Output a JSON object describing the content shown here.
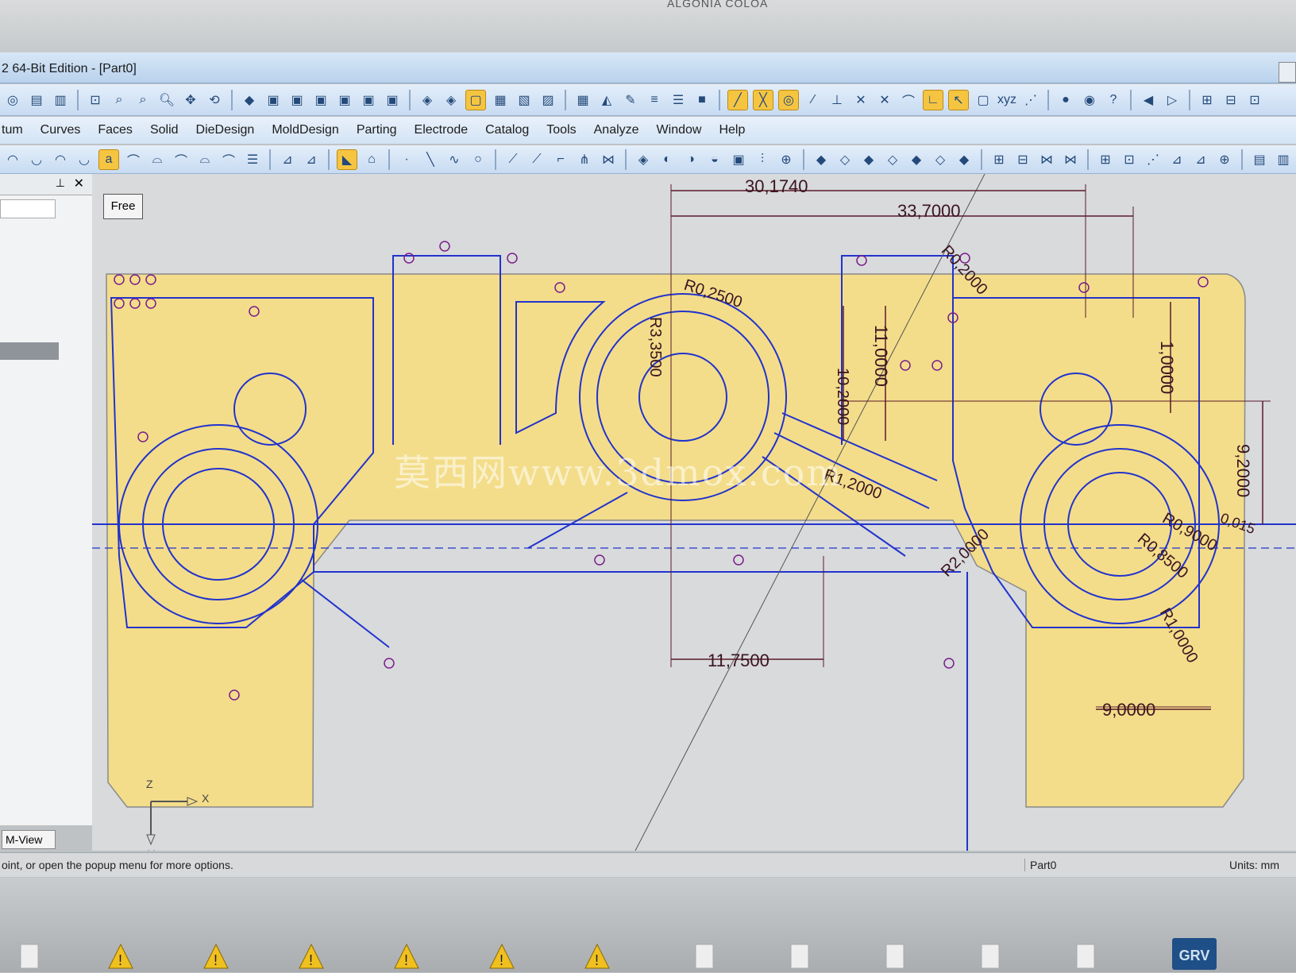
{
  "window": {
    "title": "2 64-Bit Edition - [Part0]"
  },
  "monitor": {
    "brand": "ALGONIA COLOA"
  },
  "menu": [
    "tum",
    "Curves",
    "Faces",
    "Solid",
    "DieDesign",
    "MoldDesign",
    "Parting",
    "Electrode",
    "Catalog",
    "Tools",
    "Analyze",
    "Window",
    "Help"
  ],
  "panel": {
    "pin_icon": "pin-icon",
    "close_icon": "close-icon",
    "view_tab": "M-View"
  },
  "viewport": {
    "mode_label": "Free",
    "dimensions": {
      "d1": "30,1740",
      "d2": "33,7000",
      "d3": "11,7500",
      "d4": "9,0000",
      "d5": "9,2000",
      "d6": "11,0000",
      "d7": "10,2000",
      "d8": "1,0000",
      "d9": "R0,2500",
      "d10": "R0,2000",
      "d11": "R2,0000",
      "d12": "R1,2000",
      "d13": "R1,0000",
      "d14": "R0,8500",
      "d15": "R0,9000",
      "d16": "R3,3500",
      "d17": "0,015"
    },
    "axis": {
      "x": "X",
      "y": "Y",
      "z": "Z"
    },
    "watermark": "莫西网www.3dmox.com"
  },
  "status": {
    "message": "oint, or open the popup menu for more options.",
    "part": "Part0",
    "units": "Units: mm"
  },
  "taskbar": {
    "app_label": "GRV"
  },
  "colors": {
    "sheet": "#f3dd8a",
    "line": "#2233cc",
    "dim": "#5a1a2a",
    "constraint": "#7a1d8a"
  }
}
